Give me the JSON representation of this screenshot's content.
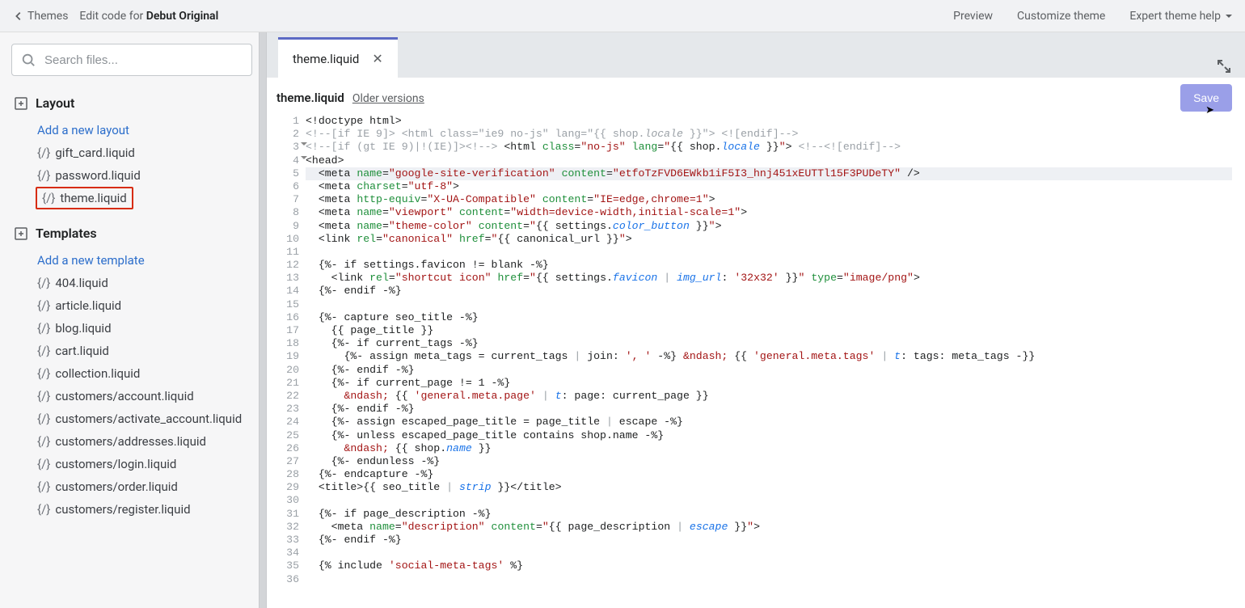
{
  "topbar": {
    "back": "Themes",
    "title_prefix": "Edit code for ",
    "title_theme": "Debut Original",
    "preview": "Preview",
    "customize": "Customize theme",
    "expert": "Expert theme help"
  },
  "sidebar": {
    "search_placeholder": "Search files...",
    "layout_label": "Layout",
    "add_layout": "Add a new layout",
    "layout_files": [
      "gift_card.liquid",
      "password.liquid",
      "theme.liquid"
    ],
    "templates_label": "Templates",
    "add_template": "Add a new template",
    "template_files": [
      "404.liquid",
      "article.liquid",
      "blog.liquid",
      "cart.liquid",
      "collection.liquid",
      "customers/account.liquid",
      "customers/activate_account.liquid",
      "customers/addresses.liquid",
      "customers/login.liquid",
      "customers/order.liquid",
      "customers/register.liquid"
    ]
  },
  "editor": {
    "tab_label": "theme.liquid",
    "file_label": "theme.liquid",
    "older_versions": "Older versions",
    "save": "Save",
    "fold_lines": [
      3,
      4
    ],
    "highlighted_line": 5,
    "code_lines": [
      {
        "n": 1,
        "html": "&lt;!doctype html&gt;"
      },
      {
        "n": 2,
        "html": "<span class='c-gray'>&lt;!--[if IE 9]&gt; &lt;html class=\"ie9 no-js\" lang=\"{{ shop.<span class='c-em'>locale</span> }}\"&gt; &lt;![endif]--&gt;</span>"
      },
      {
        "n": 3,
        "html": "<span class='c-gray'>&lt;!--[if (gt IE 9)|!(IE)]&gt;&lt;!--&gt;</span> &lt;html <span class='c-tag'>class</span>=<span class='c-str'>\"no-js\"</span> <span class='c-tag'>lang</span>=<span class='c-str'>\"</span>{{ shop.<span class='c-it'>locale</span> }}<span class='c-str'>\"</span>&gt; <span class='c-gray'>&lt;!--&lt;![endif]--&gt;</span>"
      },
      {
        "n": 4,
        "html": "&lt;head&gt;"
      },
      {
        "n": 5,
        "html": "  &lt;meta <span class='c-tag'>name</span>=<span class='c-str'>\"google-site-verification\"</span> <span class='c-tag'>content</span>=<span class='c-str'>\"etfoTzFVD6EWkb1iF5I3_hnj451xEUTTl15F3PUDeTY\"</span> /&gt;"
      },
      {
        "n": 6,
        "html": "  &lt;meta <span class='c-tag'>charset</span>=<span class='c-str'>\"utf-8\"</span>&gt;"
      },
      {
        "n": 7,
        "html": "  &lt;meta <span class='c-tag'>http-equiv</span>=<span class='c-str'>\"X-UA-Compatible\"</span> <span class='c-tag'>content</span>=<span class='c-str'>\"IE=edge,chrome=1\"</span>&gt;"
      },
      {
        "n": 8,
        "html": "  &lt;meta <span class='c-tag'>name</span>=<span class='c-str'>\"viewport\"</span> <span class='c-tag'>content</span>=<span class='c-str'>\"width=device-width,initial-scale=1\"</span>&gt;"
      },
      {
        "n": 9,
        "html": "  &lt;meta <span class='c-tag'>name</span>=<span class='c-str'>\"theme-color\"</span> <span class='c-tag'>content</span>=<span class='c-str'>\"</span>{{ settings.<span class='c-it'>color_button</span> }}<span class='c-str'>\"</span>&gt;"
      },
      {
        "n": 10,
        "html": "  &lt;link <span class='c-tag'>rel</span>=<span class='c-str'>\"canonical\"</span> <span class='c-tag'>href</span>=<span class='c-str'>\"</span>{{ canonical_url }}<span class='c-str'>\"</span>&gt;"
      },
      {
        "n": 11,
        "html": ""
      },
      {
        "n": 12,
        "html": "  {%- if settings.favicon != blank -%}"
      },
      {
        "n": 13,
        "html": "    &lt;link <span class='c-tag'>rel</span>=<span class='c-str'>\"shortcut icon\"</span> <span class='c-tag'>href</span>=<span class='c-str'>\"</span>{{ settings.<span class='c-it'>favicon</span> <span class='c-gray'>|</span> <span class='c-it'>img_url</span>: <span class='c-str'>'32x32'</span> }}<span class='c-str'>\"</span> <span class='c-tag'>type</span>=<span class='c-str'>\"image/png\"</span>&gt;"
      },
      {
        "n": 14,
        "html": "  {%- endif -%}"
      },
      {
        "n": 15,
        "html": ""
      },
      {
        "n": 16,
        "html": "  {%- capture seo_title -%}"
      },
      {
        "n": 17,
        "html": "    {{ page_title }}"
      },
      {
        "n": 18,
        "html": "    {%- if current_tags -%}"
      },
      {
        "n": 19,
        "html": "      {%- assign meta_tags = current_tags <span class='c-gray'>|</span> join: <span class='c-str'>', '</span> -%} <span class='c-str'>&amp;ndash;</span> {{ <span class='c-str'>'general.meta.tags'</span> <span class='c-gray'>|</span> <span class='c-it'>t</span>: tags: meta_tags -}}"
      },
      {
        "n": 20,
        "html": "    {%- endif -%}"
      },
      {
        "n": 21,
        "html": "    {%- if current_page != 1 -%}"
      },
      {
        "n": 22,
        "html": "      <span class='c-str'>&amp;ndash;</span> {{ <span class='c-str'>'general.meta.page'</span> <span class='c-gray'>|</span> <span class='c-it'>t</span>: page: current_page }}"
      },
      {
        "n": 23,
        "html": "    {%- endif -%}"
      },
      {
        "n": 24,
        "html": "    {%- assign escaped_page_title = page_title <span class='c-gray'>|</span> escape -%}"
      },
      {
        "n": 25,
        "html": "    {%- unless escaped_page_title contains shop.name -%}"
      },
      {
        "n": 26,
        "html": "      <span class='c-str'>&amp;ndash;</span> {{ shop.<span class='c-it'>name</span> }}"
      },
      {
        "n": 27,
        "html": "    {%- endunless -%}"
      },
      {
        "n": 28,
        "html": "  {%- endcapture -%}"
      },
      {
        "n": 29,
        "html": "  &lt;title&gt;{{ seo_title <span class='c-gray'>|</span> <span class='c-it'>strip</span> }}&lt;/title&gt;"
      },
      {
        "n": 30,
        "html": ""
      },
      {
        "n": 31,
        "html": "  {%- if page_description -%}"
      },
      {
        "n": 32,
        "html": "    &lt;meta <span class='c-tag'>name</span>=<span class='c-str'>\"description\"</span> <span class='c-tag'>content</span>=<span class='c-str'>\"</span>{{ page_description <span class='c-gray'>|</span> <span class='c-it'>escape</span> }}<span class='c-str'>\"</span>&gt;"
      },
      {
        "n": 33,
        "html": "  {%- endif -%}"
      },
      {
        "n": 34,
        "html": ""
      },
      {
        "n": 35,
        "html": "  {% include <span class='c-str'>'social-meta-tags'</span> %}"
      },
      {
        "n": 36,
        "html": ""
      }
    ]
  }
}
